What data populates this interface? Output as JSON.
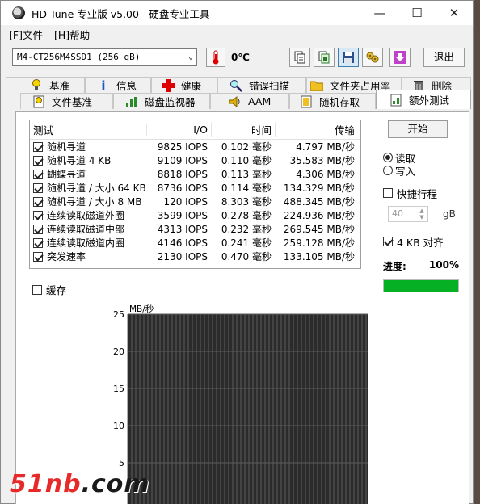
{
  "window": {
    "title": "HD Tune 专业版 v5.00 - 硬盘专业工具",
    "controls": {
      "minimize": "—",
      "maximize": "☐",
      "close": "✕"
    }
  },
  "menu": {
    "file": "[F]文件",
    "help": "[H]帮助"
  },
  "toolbar": {
    "drive": "M4-CT256M4SSD1 (256 gB)",
    "temperature": "0℃",
    "exit_label": "退出",
    "icons": [
      "copy-info-icon",
      "copy-screen-icon",
      "save-icon",
      "settings-icon",
      "download-icon"
    ]
  },
  "tabs_row1": [
    {
      "label": "基准",
      "icon": "benchmark-icon"
    },
    {
      "label": "信息",
      "icon": "info-icon"
    },
    {
      "label": "健康",
      "icon": "health-icon"
    },
    {
      "label": "错误扫描",
      "icon": "error-scan-icon"
    },
    {
      "label": "文件夹占用率",
      "icon": "folder-usage-icon"
    },
    {
      "label": "删除",
      "icon": "erase-icon"
    }
  ],
  "tabs_row2": [
    {
      "label": "文件基准",
      "icon": "file-benchmark-icon"
    },
    {
      "label": "磁盘监视器",
      "icon": "disk-monitor-icon"
    },
    {
      "label": "AAM",
      "icon": "aam-icon"
    },
    {
      "label": "随机存取",
      "icon": "random-access-icon"
    },
    {
      "label": "额外测试",
      "icon": "extra-tests-icon",
      "active": true
    }
  ],
  "results": {
    "headers": {
      "test": "测试",
      "io": "I/O",
      "time": "时间",
      "rate": "传输"
    },
    "rows": [
      {
        "name": "随机寻道",
        "io": "9825 IOPS",
        "time": "0.102 毫秒",
        "rate": "4.797 MB/秒"
      },
      {
        "name": "随机寻道 4 KB",
        "io": "9109 IOPS",
        "time": "0.110 毫秒",
        "rate": "35.583 MB/秒"
      },
      {
        "name": "蝴蝶寻道",
        "io": "8818 IOPS",
        "time": "0.113 毫秒",
        "rate": "4.306 MB/秒"
      },
      {
        "name": "随机寻道 / 大小 64 KB",
        "io": "8736 IOPS",
        "time": "0.114 毫秒",
        "rate": "134.329 MB/秒"
      },
      {
        "name": "随机寻道 / 大小 8 MB",
        "io": "120 IOPS",
        "time": "8.303 毫秒",
        "rate": "488.345 MB/秒"
      },
      {
        "name": "连续读取磁道外圈",
        "io": "3599 IOPS",
        "time": "0.278 毫秒",
        "rate": "224.936 MB/秒"
      },
      {
        "name": "连续读取磁道中部",
        "io": "4313 IOPS",
        "time": "0.232 毫秒",
        "rate": "269.545 MB/秒"
      },
      {
        "name": "连续读取磁道内圈",
        "io": "4146 IOPS",
        "time": "0.241 毫秒",
        "rate": "259.128 MB/秒"
      },
      {
        "name": "突发速率",
        "io": "2130 IOPS",
        "time": "0.470 毫秒",
        "rate": "133.105 MB/秒"
      }
    ]
  },
  "options": {
    "start_label": "开始",
    "read_label": "读取",
    "write_label": "写入",
    "read_selected": true,
    "short_stroke_label": "快捷行程",
    "short_stroke_value": "40",
    "short_stroke_unit": "gB",
    "align_4kb_label": "4 KB 对齐",
    "progress_label": "进度:",
    "progress_value": "100%",
    "progress_fraction": 1.0,
    "progress_color": "#06b025",
    "cache_label": "缓存"
  },
  "chart_data": {
    "type": "line",
    "ylabel": "MB/秒",
    "ylim": [
      0,
      25
    ],
    "yticks": [
      "25",
      "20",
      "15",
      "10",
      "5"
    ],
    "series": [],
    "grid": true,
    "background": "#2b2b2b",
    "grid_color": "#5c5c5c"
  },
  "watermark": {
    "text_a": "51nb",
    "text_b": ".com"
  }
}
